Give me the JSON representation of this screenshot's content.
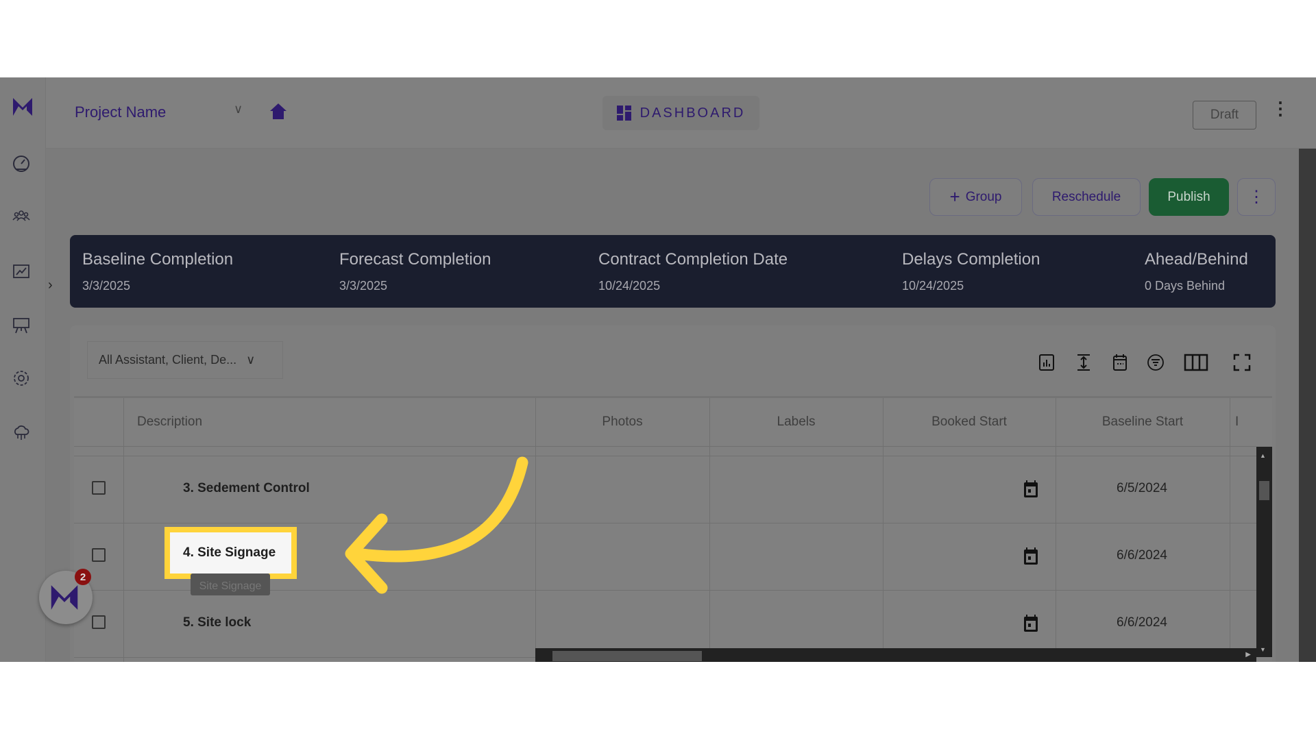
{
  "header": {
    "project_name": "Project Name",
    "dashboard_label": "DASHBOARD",
    "status_label": "Draft"
  },
  "sidebar": {
    "items": [
      {
        "icon": "gauge-icon"
      },
      {
        "icon": "users-icon"
      },
      {
        "icon": "chart-line-icon"
      },
      {
        "icon": "presentation-icon"
      },
      {
        "icon": "gear-icon"
      },
      {
        "icon": "cloud-network-icon"
      }
    ]
  },
  "actions": {
    "group_label": "Group",
    "reschedule_label": "Reschedule",
    "publish_label": "Publish"
  },
  "summary": [
    {
      "label": "Baseline Completion",
      "value": "3/3/2025"
    },
    {
      "label": "Forecast Completion",
      "value": "3/3/2025"
    },
    {
      "label": "Contract Completion Date",
      "value": "10/24/2025"
    },
    {
      "label": "Delays Completion",
      "value": "10/24/2025"
    },
    {
      "label": "Ahead/Behind",
      "value": "0 Days Behind"
    }
  ],
  "filter": {
    "value": "All Assistant, Client, De..."
  },
  "toolbar": [
    "chart-bar-icon",
    "row-height-icon",
    "calendar-icon",
    "filter-circle-icon",
    "columns-icon",
    "fullscreen-icon"
  ],
  "table": {
    "columns": [
      "Description",
      "Photos",
      "Labels",
      "Booked Start",
      "Baseline Start",
      "I"
    ],
    "rows": [
      {
        "description": "3. Sedement Control",
        "baseline_start": "6/5/2024"
      },
      {
        "description": "4. Site Signage",
        "baseline_start": "6/6/2024"
      },
      {
        "description": "5. Site lock",
        "baseline_start": "6/6/2024"
      }
    ]
  },
  "tooltip": "Site Signage",
  "chat_widget": {
    "badge_count": "2"
  },
  "colors": {
    "brand_purple": "#2e1a6e",
    "publish_green": "#1a5c33",
    "banner": "#1a1e2e",
    "highlight": "#ffd43b"
  }
}
